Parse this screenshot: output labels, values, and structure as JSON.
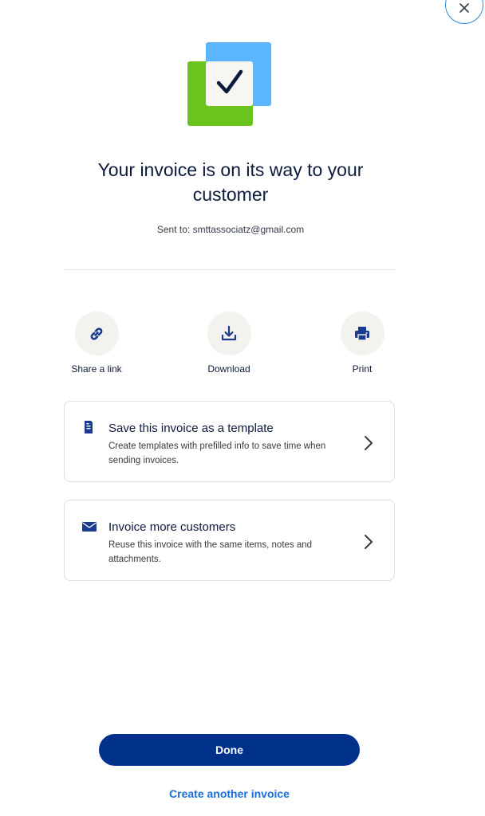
{
  "close": {
    "icon": "close-icon"
  },
  "hero": {
    "icon": "invoice-sent-check-icon",
    "colors": {
      "green": "#6bc41e",
      "blue": "#5cb6ff",
      "check": "#0d1b3e",
      "paper": "#f7f6f3"
    }
  },
  "header": {
    "title": "Your invoice is on its way to your customer",
    "sent_to": "Sent to: smttassociatz@gmail.com"
  },
  "actions": [
    {
      "label": "Share a link",
      "icon": "link-icon"
    },
    {
      "label": "Download",
      "icon": "download-icon"
    },
    {
      "label": "Print",
      "icon": "printer-icon"
    }
  ],
  "cards": [
    {
      "title": "Save this invoice as a template",
      "description": "Create templates with prefilled info to save time when sending invoices.",
      "icon": "document-icon"
    },
    {
      "title": "Invoice more customers",
      "description": "Reuse this invoice with the same items, notes and attachments.",
      "icon": "envelope-icon"
    }
  ],
  "footer": {
    "done_label": "Done",
    "create_label": "Create another invoice"
  },
  "colors": {
    "primary": "#00318a",
    "link": "#1a6fdb",
    "text": "#0d1b3e",
    "icon": "#1a3c8f"
  }
}
